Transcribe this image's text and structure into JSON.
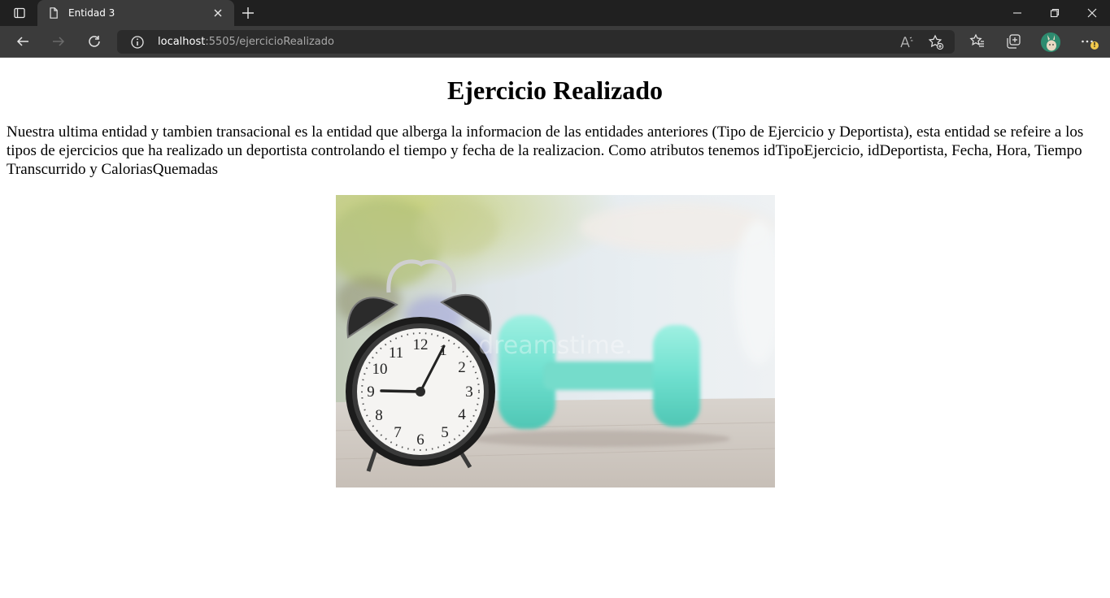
{
  "browser": {
    "tab": {
      "title": "Entidad 3",
      "favicon": "page-icon"
    },
    "address_bar": {
      "host": "localhost",
      "path": ":5505/ejercicioRealizado"
    },
    "toolbar_icons": [
      "back-icon",
      "forward-icon",
      "refresh-icon",
      "site-info-icon",
      "read-aloud-icon",
      "add-favorite-icon",
      "favorites-icon",
      "collections-icon",
      "profile-avatar",
      "more-icon"
    ],
    "window_controls": [
      "minimize-icon",
      "restore-icon",
      "close-icon"
    ],
    "accent_colors": {
      "titlebar": "#202020",
      "toolbar": "#3b3b3b",
      "omnibox": "#2b2b2b"
    }
  },
  "page": {
    "title": "Ejercicio Realizado",
    "description": "Nuestra ultima entidad y tambien transacional es la entidad que alberga la informacion de las entidades anteriores (Tipo de Ejercicio y Deportista), esta entidad se refeire a los tipos de ejercicios que ha realizado un deportista controlando el tiempo y fecha de la realizacion. Como atributos tenemos idTipoEjercicio, idDeportista, Fecha, Hora, Tiempo Transcurrido y CaloriasQuemadas",
    "image": {
      "clock_numbers": [
        "12",
        "1",
        "2",
        "3",
        "4",
        "5",
        "6",
        "7",
        "8",
        "9",
        "10",
        "11"
      ],
      "watermark": "dreamstime."
    }
  }
}
